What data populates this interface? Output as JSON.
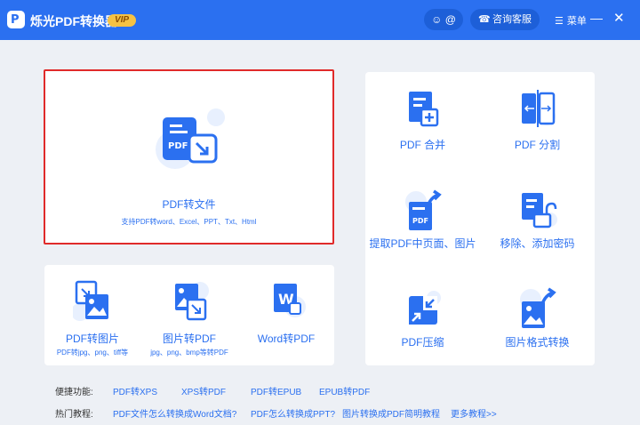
{
  "titlebar": {
    "logo_letter": "P",
    "app_title": "烁光PDF转换器",
    "vip_badge": "VIP",
    "user_button": "@",
    "service_button": "咨询客服",
    "menu_label": "菜单"
  },
  "main_feature": {
    "icon_text": "PDF",
    "title": "PDF转文件",
    "subtitle": "支持PDF转word、Excel、PPT、Txt、Html"
  },
  "bottom_tools": [
    {
      "title": "PDF转图片",
      "subtitle": "PDF转jpg、png、tiff等"
    },
    {
      "title": "图片转PDF",
      "subtitle": "jpg、png、bmp等转PDF"
    },
    {
      "title": "Word转PDF",
      "subtitle": ""
    }
  ],
  "right_tools": [
    {
      "title": "PDF 合并"
    },
    {
      "title": "PDF 分割"
    },
    {
      "title": "提取PDF中页面、图片"
    },
    {
      "title": "移除、添加密码"
    },
    {
      "title": "PDF压缩"
    },
    {
      "title": "图片格式转换"
    }
  ],
  "footer": {
    "quick_label": "便捷功能:",
    "quick_links": [
      "PDF转XPS",
      "XPS转PDF",
      "PDF转EPUB",
      "EPUB转PDF"
    ],
    "tutorial_label": "热门教程:",
    "tutorial_links": [
      "PDF文件怎么转换成Word文档?",
      "PDF怎么转换成PPT?",
      "图片转换成PDF简明教程",
      "更多教程>>"
    ]
  },
  "colors": {
    "titlebar": "#2b70f0",
    "accent": "#2b70f0",
    "highlight_border": "#e02a2a",
    "background": "#edf0f5"
  }
}
